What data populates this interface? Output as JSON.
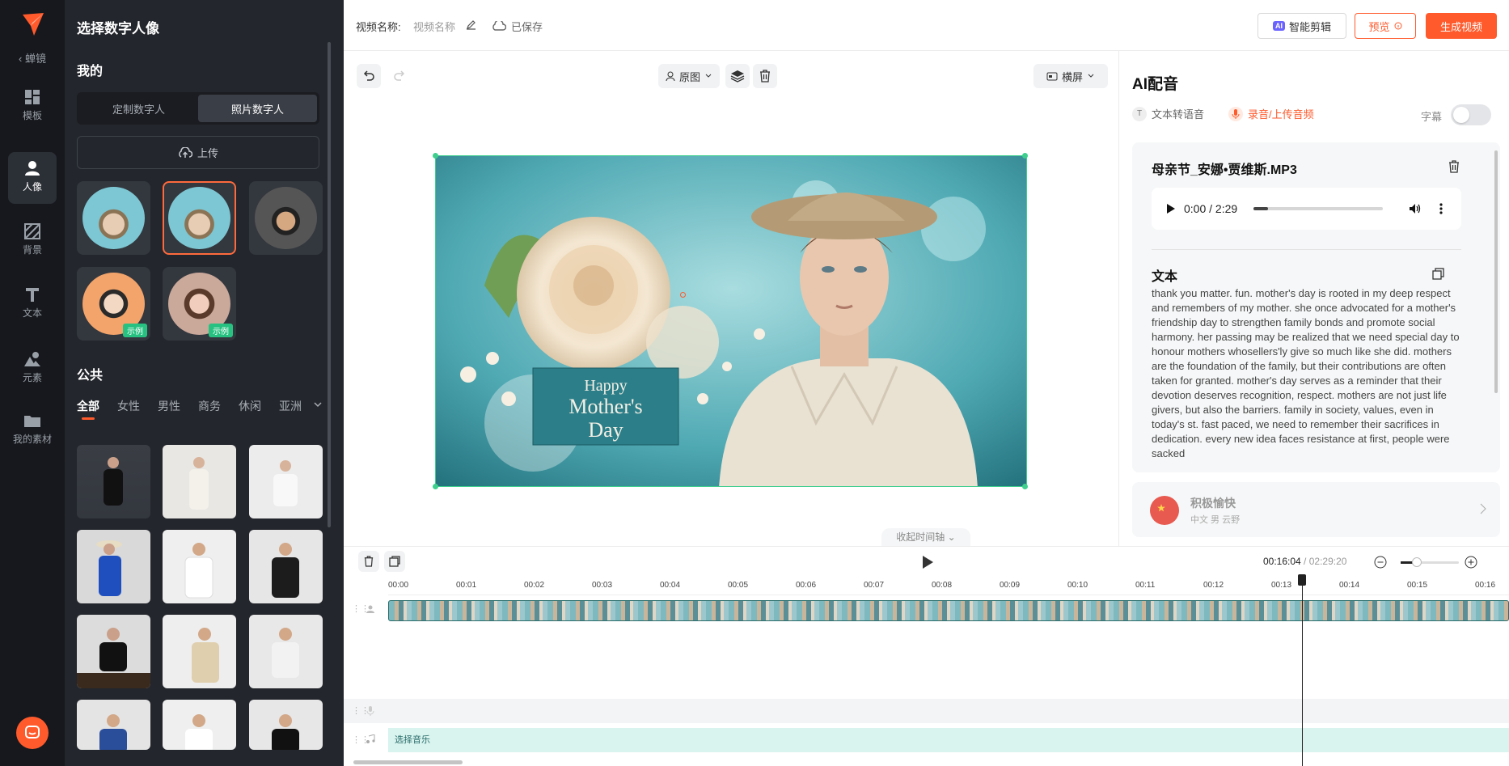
{
  "rail": {
    "back_label": "蝉镜",
    "items": [
      {
        "label": "模板",
        "icon": "grid-icon"
      },
      {
        "label": "人像",
        "icon": "person-icon"
      },
      {
        "label": "背景",
        "icon": "background-icon"
      },
      {
        "label": "文本",
        "icon": "text-icon"
      },
      {
        "label": "元素",
        "icon": "element-icon"
      },
      {
        "label": "我的素材",
        "icon": "folder-icon"
      }
    ]
  },
  "panel": {
    "title": "选择数字人像",
    "mine_heading": "我的",
    "seg": [
      "定制数字人",
      "照片数字人"
    ],
    "upload_label": "上传",
    "example_tag": "示例",
    "public_heading": "公共",
    "filters": [
      "全部",
      "女性",
      "男性",
      "商务",
      "休闲",
      "亚洲"
    ]
  },
  "topbar": {
    "name_label": "视频名称:",
    "name_value": "视频名称",
    "saved_label": "已保存",
    "ai_badge": "AI",
    "ai_label": "智能剪辑",
    "preview_label": "预览",
    "generate_label": "生成视频"
  },
  "canvas": {
    "original_label": "原图",
    "orientation_label": "横屏",
    "fold_label": "收起时间轴",
    "poster_happy": "Happy",
    "poster_mothers": "Mother's",
    "poster_day": "Day"
  },
  "right": {
    "title": "AI配音",
    "tab_tts": "文本转语音",
    "tab_record": "录音/上传音频",
    "subtitle_label": "字幕",
    "file_name": "母亲节_安娜•贾维斯.MP3",
    "audio_time": "0:00 / 2:29",
    "text_label": "文本",
    "text_body": "thank you matter. fun. mother's day is rooted in my deep respect and remembers of my mother. she once advocated for a mother's friendship day to strengthen family bonds and promote social harmony. her passing may be realized that we need special day to honour mothers whosellers'ly give so much like she did. mothers are the foundation of the family, but their contributions are often taken for granted. mother's day serves as a reminder that their devotion deserves recognition, respect. mothers are not just life givers, but also the barriers. family in society, values, even in today's st. fast paced, we need to remember their sacrifices in dedication. every new idea faces resistance at first, people were sacked",
    "voice_name": "积极愉快",
    "voice_meta": "中文  男 云野"
  },
  "timeline": {
    "current": "00:16:04",
    "separator": " / ",
    "total": "02:29:20",
    "ticks": [
      "00:00",
      "00:01",
      "00:02",
      "00:03",
      "00:04",
      "00:05",
      "00:06",
      "00:07",
      "00:08",
      "00:09",
      "00:10",
      "00:11",
      "00:12",
      "00:13",
      "00:14",
      "00:15",
      "00:16"
    ],
    "music_label": "选择音乐"
  }
}
